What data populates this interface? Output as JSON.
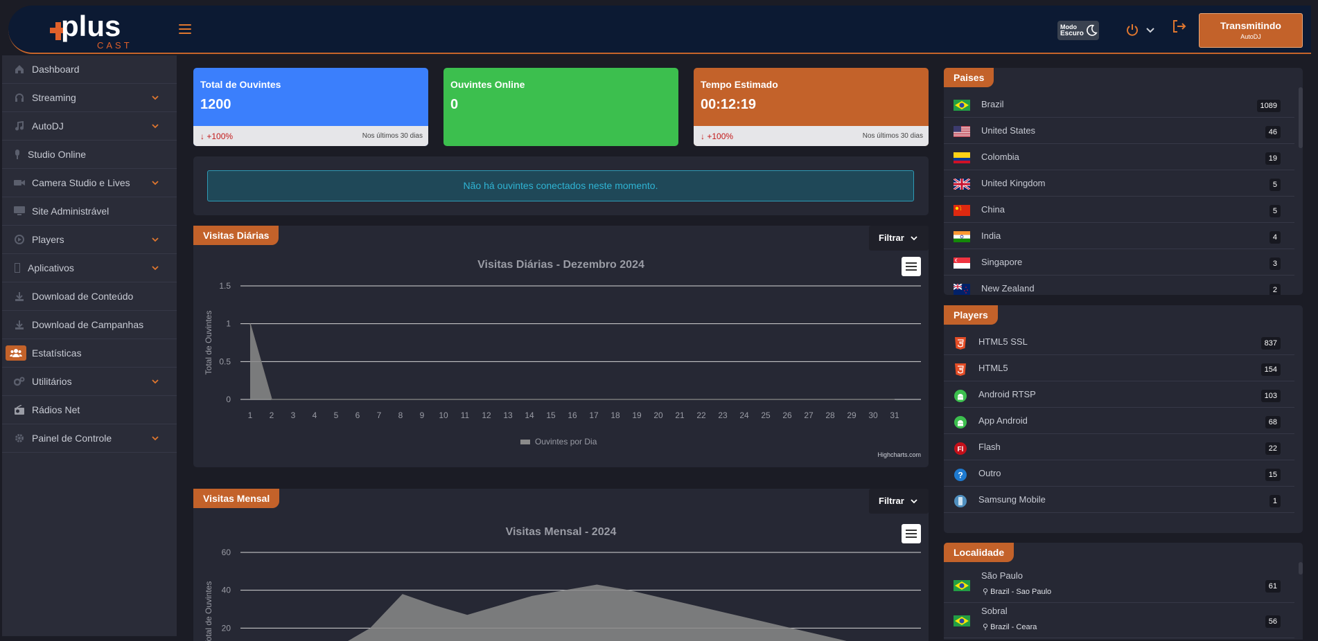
{
  "header": {
    "logo_plus": "plus",
    "logo_cast": "CAST",
    "dark_mode_line1": "Modo",
    "dark_mode_line2": "Escuro",
    "broadcast_button": "Transmitindo",
    "broadcast_sub": "AutoDJ",
    "accent_color": "#c3622a"
  },
  "sidebar": {
    "items": [
      {
        "label": "Dashboard",
        "icon": "home-icon",
        "has_submenu": false
      },
      {
        "label": "Streaming",
        "icon": "headphones-icon",
        "has_submenu": true
      },
      {
        "label": "AutoDJ",
        "icon": "music-note-icon",
        "has_submenu": true
      },
      {
        "label": "Studio Online",
        "icon": "microphone-icon",
        "has_submenu": false
      },
      {
        "label": "Camera Studio e Lives",
        "icon": "video-camera-icon",
        "has_submenu": true
      },
      {
        "label": "Site Administrável",
        "icon": "monitor-icon",
        "has_submenu": false
      },
      {
        "label": "Players",
        "icon": "play-circle-icon",
        "has_submenu": true
      },
      {
        "label": "Aplicativos",
        "icon": "mobile-icon",
        "has_submenu": true
      },
      {
        "label": "Download de Conteúdo",
        "icon": "download-icon",
        "has_submenu": false
      },
      {
        "label": "Download de Campanhas",
        "icon": "download-icon",
        "has_submenu": false
      },
      {
        "label": "Estatísticas",
        "icon": "users-icon",
        "has_submenu": false,
        "active": true
      },
      {
        "label": "Utilitários",
        "icon": "gears-icon",
        "has_submenu": true
      },
      {
        "label": "Rádios Net",
        "icon": "radio-icon",
        "has_submenu": false
      },
      {
        "label": "Painel de Controle",
        "icon": "gear-icon",
        "has_submenu": true
      }
    ]
  },
  "stats": {
    "total": {
      "title": "Total de Ouvintes",
      "value": "1200",
      "delta": "+100%",
      "period": "Nos últimos 30 dias",
      "color": "#3b7ffc"
    },
    "online": {
      "title": "Ouvintes Online",
      "value": "0",
      "color": "#3cbf4e"
    },
    "tempo": {
      "title": "Tempo Estimado",
      "value": "00:12:19",
      "delta": "+100%",
      "period": "Nos últimos 30 dias",
      "color": "#c3622a"
    }
  },
  "alert_text": "Não há ouvintes conectados neste momento.",
  "daily": {
    "tag": "Visitas Diárias",
    "filter": "Filtrar",
    "credit": "Highcharts.com"
  },
  "monthly": {
    "tag": "Visitas Mensal",
    "filter": "Filtrar"
  },
  "chart_data": [
    {
      "type": "area",
      "title": "Visitas Diárias - Dezembro 2024",
      "ylabel": "Total de Ouvintes",
      "xlabel": "",
      "categories": [
        "1",
        "2",
        "3",
        "4",
        "5",
        "6",
        "7",
        "8",
        "9",
        "10",
        "11",
        "12",
        "13",
        "14",
        "15",
        "16",
        "17",
        "18",
        "19",
        "20",
        "21",
        "22",
        "23",
        "24",
        "25",
        "26",
        "27",
        "28",
        "29",
        "30",
        "31"
      ],
      "y_ticks": [
        "0",
        "0.5",
        "1",
        "1.5"
      ],
      "ylim": [
        0,
        1.5
      ],
      "series": [
        {
          "name": "Ouvintes por Dia",
          "values": [
            1,
            0,
            0,
            0,
            0,
            0,
            0,
            0,
            0,
            0,
            0,
            0,
            0,
            0,
            0,
            0,
            0,
            0,
            0,
            0,
            0,
            0,
            0,
            0,
            0,
            0,
            0,
            0,
            0,
            0,
            0
          ]
        }
      ],
      "legend": "bottom-center",
      "grid": true
    },
    {
      "type": "area",
      "title": "Visitas Mensal - 2024",
      "ylabel": "Total de Ouvintes",
      "xlabel": "",
      "y_ticks": [
        "20",
        "40",
        "60"
      ],
      "ylim": [
        0,
        60
      ],
      "series": [
        {
          "values": [
            0,
            0,
            0,
            10,
            20,
            38,
            32,
            27,
            32,
            37,
            40,
            43,
            40,
            36,
            32,
            28,
            24,
            20,
            16,
            12,
            8,
            4
          ]
        }
      ],
      "grid": true
    }
  ],
  "countries": {
    "tag": "Paises",
    "items": [
      {
        "name": "Brazil",
        "count": "1089",
        "flag": "flag-brazil"
      },
      {
        "name": "United States",
        "count": "46",
        "flag": "flag-us"
      },
      {
        "name": "Colombia",
        "count": "19",
        "flag": "flag-colombia"
      },
      {
        "name": "United Kingdom",
        "count": "5",
        "flag": "flag-uk"
      },
      {
        "name": "China",
        "count": "5",
        "flag": "flag-china"
      },
      {
        "name": "India",
        "count": "4",
        "flag": "flag-india"
      },
      {
        "name": "Singapore",
        "count": "3",
        "flag": "flag-singapore"
      },
      {
        "name": "New Zealand",
        "count": "2",
        "flag": "flag-newzealand"
      }
    ]
  },
  "players": {
    "tag": "Players",
    "items": [
      {
        "name": "HTML5 SSL",
        "count": "837",
        "icon": "html5-icon"
      },
      {
        "name": "HTML5",
        "count": "154",
        "icon": "html5-icon"
      },
      {
        "name": "Android RTSP",
        "count": "103",
        "icon": "android-icon"
      },
      {
        "name": "App Android",
        "count": "68",
        "icon": "android-icon"
      },
      {
        "name": "Flash",
        "count": "22",
        "icon": "flash-icon"
      },
      {
        "name": "Outro",
        "count": "15",
        "icon": "question-icon"
      },
      {
        "name": "Samsung Mobile",
        "count": "1",
        "icon": "phone-icon"
      }
    ]
  },
  "locations": {
    "tag": "Localidade",
    "items": [
      {
        "name": "São Paulo",
        "sub": "Brazil - Sao Paulo",
        "count": "61"
      },
      {
        "name": "Sobral",
        "sub": "Brazil - Ceara",
        "count": "56"
      }
    ]
  }
}
